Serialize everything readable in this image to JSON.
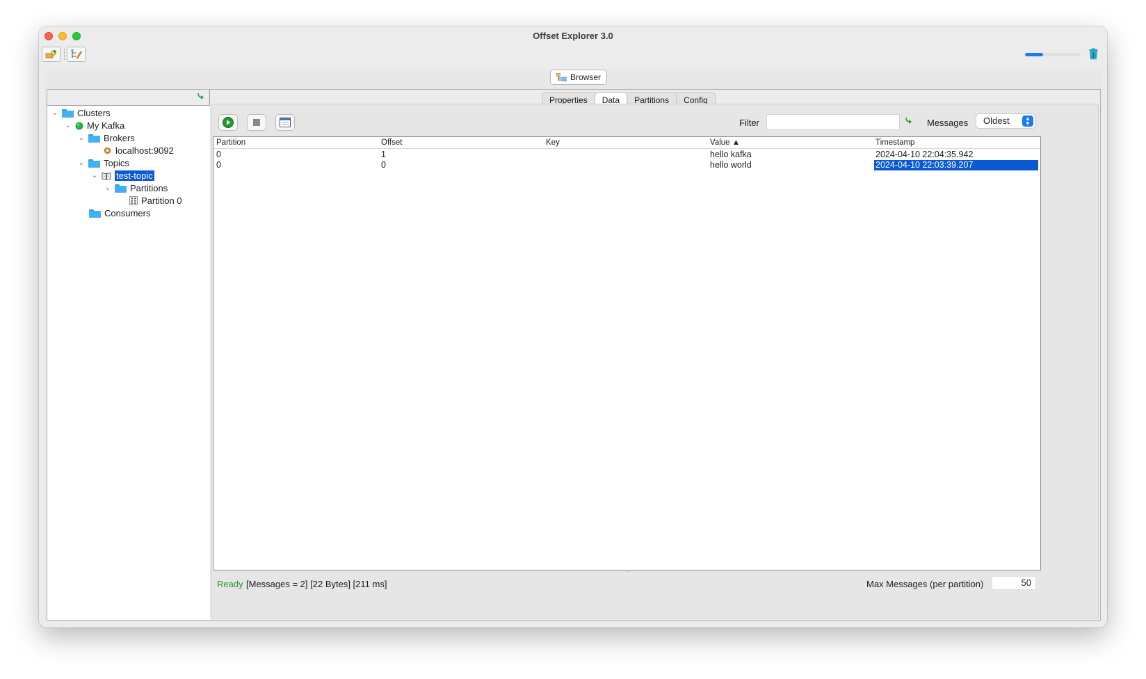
{
  "window": {
    "title": "Offset Explorer  3.0"
  },
  "toolbar": {
    "progress_fraction": 0.33
  },
  "browser_button": {
    "label": "Browser"
  },
  "tree": {
    "clusters": "Clusters",
    "cluster": "My Kafka",
    "brokers": "Brokers",
    "broker": "localhost:9092",
    "topics": "Topics",
    "topic": "test-topic",
    "partitions": "Partitions",
    "partition": "Partition 0",
    "consumers": "Consumers"
  },
  "tabs": [
    {
      "label": "Properties",
      "active": false
    },
    {
      "label": "Data",
      "active": true
    },
    {
      "label": "Partitions",
      "active": false
    },
    {
      "label": "Config",
      "active": false
    }
  ],
  "filter": {
    "label": "Filter",
    "value": ""
  },
  "messages": {
    "label": "Messages",
    "selected": "Oldest"
  },
  "table": {
    "columns": [
      "Partition",
      "Offset",
      "Key",
      "Value ▲",
      "Timestamp"
    ],
    "rows": [
      [
        "0",
        "1",
        "",
        "hello kafka",
        "2024-04-10 22:04:35.942"
      ],
      [
        "0",
        "0",
        "",
        "hello world",
        "2024-04-10 22:03:39.207"
      ]
    ],
    "selected_row": 1
  },
  "status": {
    "ready": "Ready",
    "info": "[Messages = 2]  [22 Bytes]  [211 ms]",
    "max_label": "Max Messages (per partition)",
    "max_value": "50"
  },
  "colors": {
    "accent": "#0a5ad4",
    "ready": "#1f9b2c",
    "progress": "#1a7cf5"
  }
}
